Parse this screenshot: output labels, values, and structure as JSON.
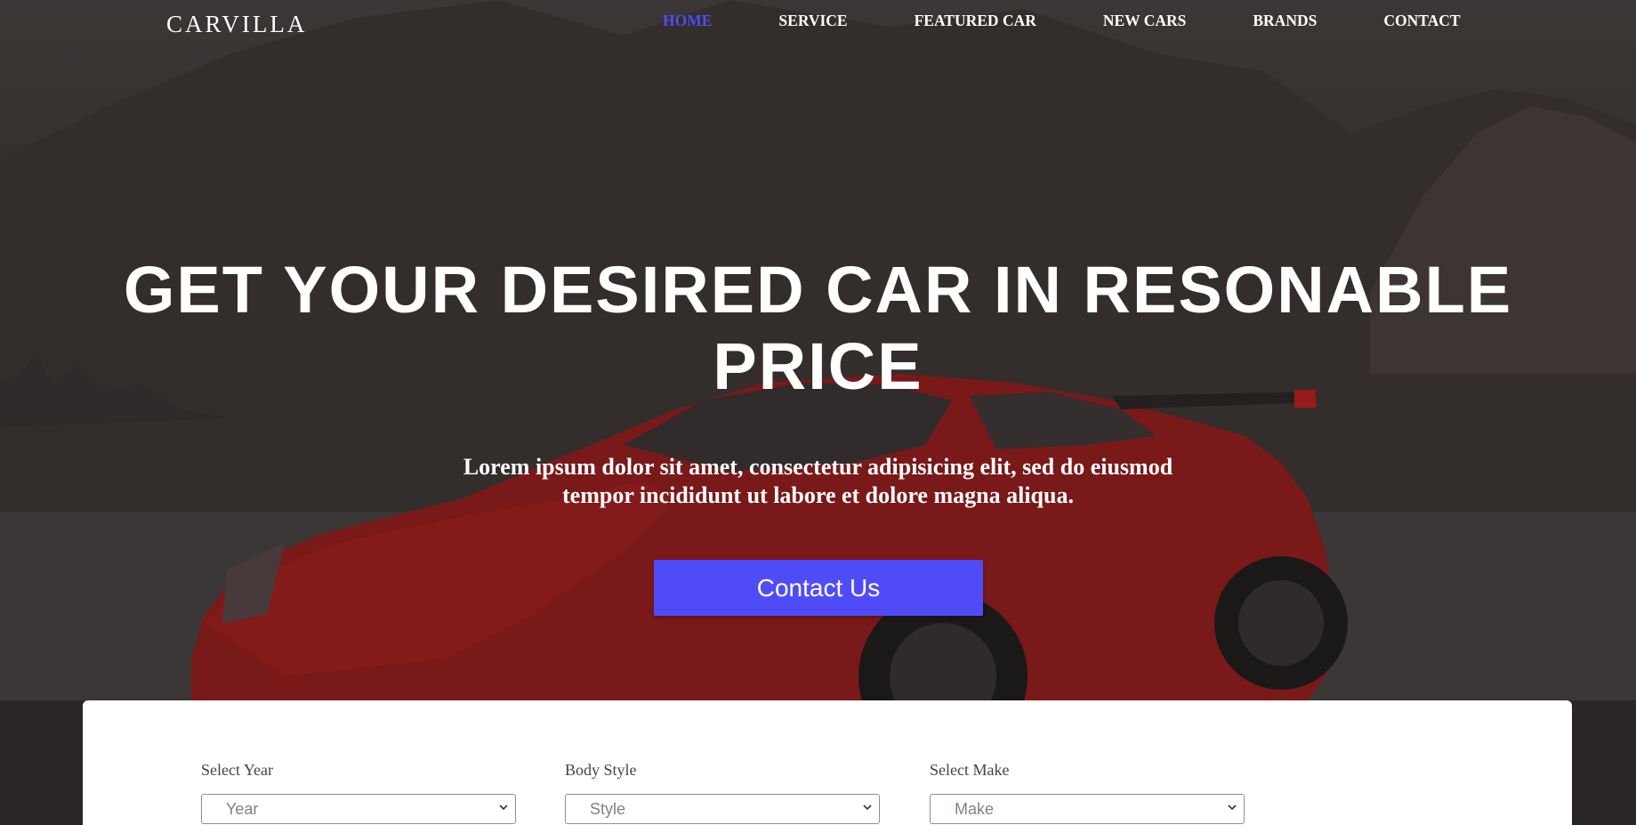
{
  "header": {
    "brand": "CARVILLA",
    "nav": [
      {
        "label": "HOME",
        "active": true
      },
      {
        "label": "SERVICE",
        "active": false
      },
      {
        "label": "FEATURED CAR",
        "active": false
      },
      {
        "label": "NEW CARS",
        "active": false
      },
      {
        "label": "BRANDS",
        "active": false
      },
      {
        "label": "CONTACT",
        "active": false
      }
    ]
  },
  "hero": {
    "headline_line1": "GET YOUR DESIRED CAR IN RESONABLE",
    "headline_line2": "PRICE",
    "subtext_line1": "Lorem ipsum dolor sit amet, consectetur adipisicing elit, sed do eiusmod",
    "subtext_line2": "tempor incididunt ut labore et dolore magna aliqua.",
    "cta_label": "Contact Us",
    "background_icon": "car-photo"
  },
  "search": {
    "fields": [
      {
        "label": "Select Year",
        "value": "Year"
      },
      {
        "label": "Body Style",
        "value": "Style"
      },
      {
        "label": "Select Make",
        "value": "Make"
      }
    ]
  },
  "colors": {
    "accent": "#4f4cf7",
    "text_on_dark": "#ffffff",
    "car_red": "#b3151a"
  }
}
